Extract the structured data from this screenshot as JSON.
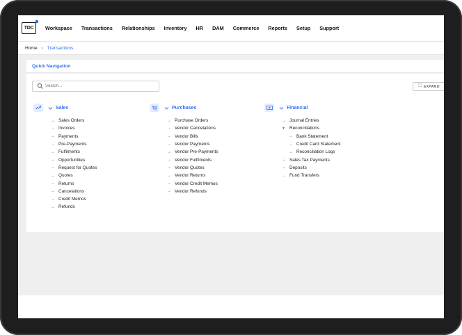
{
  "app": {
    "logo": "TDC"
  },
  "nav": [
    "Workspace",
    "Transactions",
    "Relationships",
    "Inventory",
    "HR",
    "DAM",
    "Commerce",
    "Reports",
    "Setup",
    "Support"
  ],
  "breadcrumb": {
    "home": "Home",
    "separator": "›",
    "current": "Transactions"
  },
  "quick_nav": {
    "title": "Quick Navigation",
    "search_placeholder": "Search...",
    "expand_label": "EXPAND"
  },
  "columns": [
    {
      "title": "Sales",
      "icon": "trending-up-icon",
      "items": [
        {
          "label": "Sales Orders"
        },
        {
          "label": "Invoices"
        },
        {
          "label": "Payments"
        },
        {
          "label": "Pre-Payments"
        },
        {
          "label": "Fulfilments"
        },
        {
          "label": "Opportunities"
        },
        {
          "label": "Request for Quotes"
        },
        {
          "label": "Quotes"
        },
        {
          "label": "Returns"
        },
        {
          "label": "Cancelations"
        },
        {
          "label": "Credit Memos"
        },
        {
          "label": "Refunds"
        }
      ]
    },
    {
      "title": "Purchases",
      "icon": "cart-icon",
      "items": [
        {
          "label": "Purchase Orders"
        },
        {
          "label": "Vendor Cancelations"
        },
        {
          "label": "Vendor Bills"
        },
        {
          "label": "Vendor Payments"
        },
        {
          "label": "Vendor Pre-Payments"
        },
        {
          "label": "Vendor Fulfilments"
        },
        {
          "label": "Vendor Quotes"
        },
        {
          "label": "Vendor Returns"
        },
        {
          "label": "Vendor Credit Memos"
        },
        {
          "label": "Vendor Refunds"
        }
      ]
    },
    {
      "title": "Financial",
      "icon": "money-icon",
      "items": [
        {
          "label": "Journal Entries"
        },
        {
          "label": "Reconciliations",
          "expanded": true,
          "children": [
            "Bank Statement",
            "Credit Card Statement",
            "Reconciliation Logs"
          ]
        },
        {
          "label": "Sales Tax Payments"
        },
        {
          "label": "Deposits"
        },
        {
          "label": "Fund Transfers"
        }
      ]
    }
  ],
  "colors": {
    "accent": "#2f6fec",
    "icon_bg": "#e4ecff"
  }
}
